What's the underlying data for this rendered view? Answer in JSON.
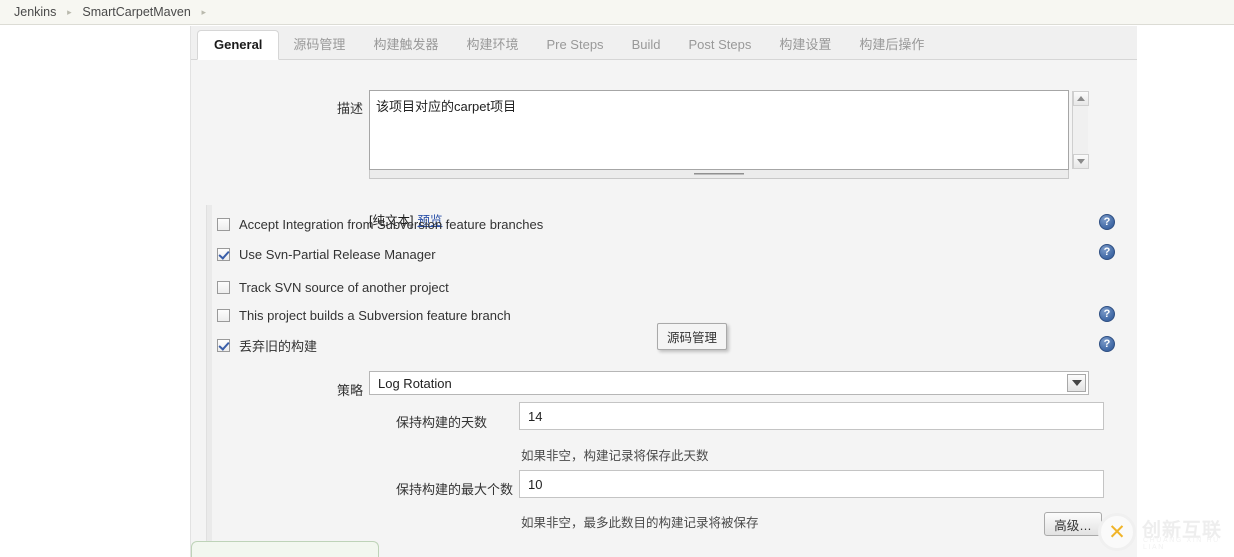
{
  "breadcrumb": {
    "items": [
      {
        "label": "Jenkins"
      },
      {
        "label": "SmartCarpetMaven"
      }
    ],
    "separator": "▸"
  },
  "tabs": [
    {
      "label": "General",
      "active": true
    },
    {
      "label": "源码管理",
      "active": false
    },
    {
      "label": "构建触发器",
      "active": false
    },
    {
      "label": "构建环境",
      "active": false
    },
    {
      "label": "Pre Steps",
      "active": false
    },
    {
      "label": "Build",
      "active": false
    },
    {
      "label": "Post Steps",
      "active": false
    },
    {
      "label": "构建设置",
      "active": false
    },
    {
      "label": "构建后操作",
      "active": false
    }
  ],
  "description": {
    "label": "描述",
    "value": "该项目对应的carpet项目",
    "format_label": "[纯文本]",
    "preview_link": "预览"
  },
  "checkboxes": [
    {
      "label": "Accept Integration from Subversion feature branches",
      "checked": false,
      "help": true
    },
    {
      "label": "Use Svn-Partial Release Manager",
      "checked": true,
      "help": true
    },
    {
      "label": "Track SVN source of another project",
      "checked": false,
      "help": false
    },
    {
      "label": "This project builds a Subversion feature branch",
      "checked": false,
      "help": true
    },
    {
      "label": "丢弃旧的构建",
      "checked": true,
      "help": true
    }
  ],
  "tooltip": {
    "text": "源码管理"
  },
  "strategy": {
    "label": "策略",
    "selected": "Log Rotation"
  },
  "fields": [
    {
      "label": "保持构建的天数",
      "value": "14",
      "help": "如果非空，构建记录将保存此天数"
    },
    {
      "label": "保持构建的最大个数",
      "value": "10",
      "help": "如果非空，最多此数目的构建记录将被保存"
    }
  ],
  "advanced_button": {
    "label": "高级…"
  },
  "help_icon_glyph": "?",
  "watermark": {
    "title": "创新互联",
    "subtitle": "CHUANG XIN HU LIAN",
    "logo_glyph": "✕"
  },
  "colors": {
    "annotation": "#ee1c11",
    "link": "#2b51a8",
    "tab_active_text": "#1a1a1a",
    "tab_inactive_text": "#999999"
  }
}
